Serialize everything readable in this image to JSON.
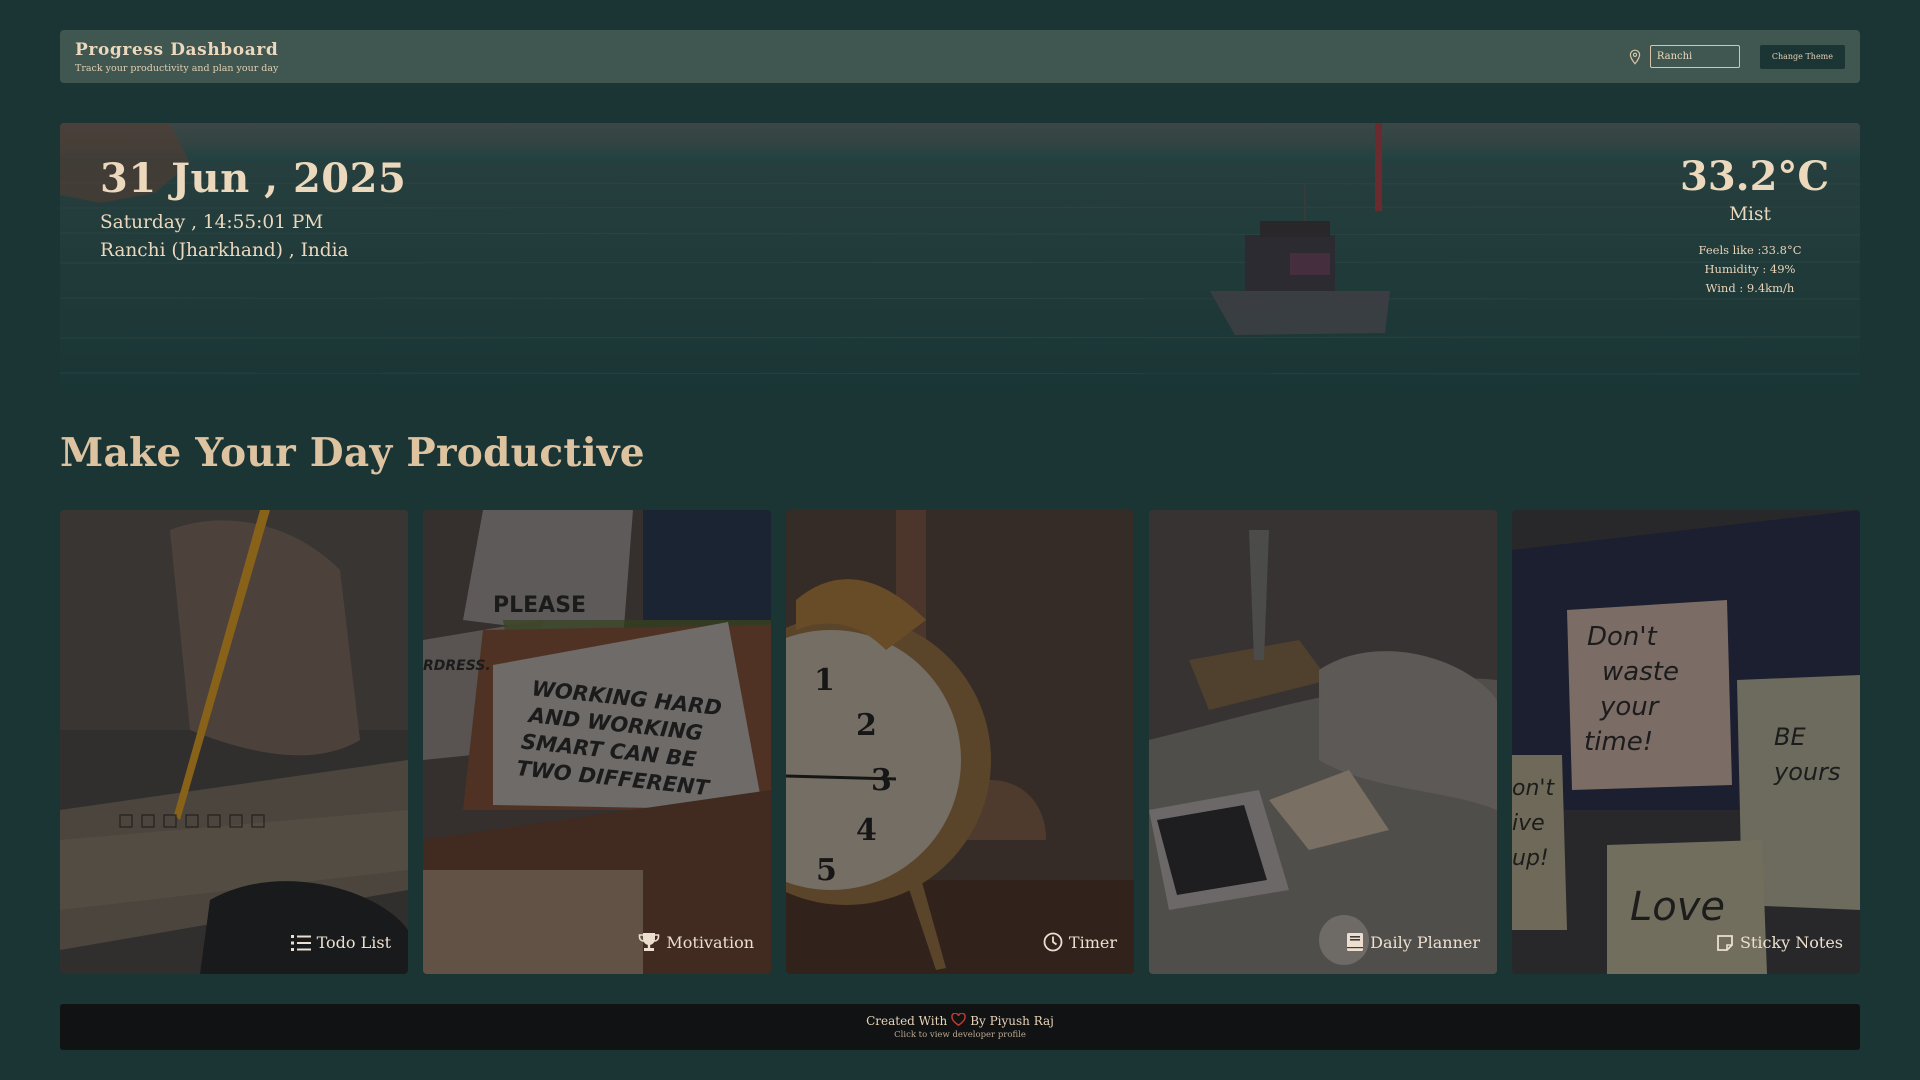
{
  "header": {
    "title": "Progress Dashboard",
    "subtitle": "Track your productivity and plan your day",
    "city_input_value": "Ranchi",
    "theme_button": "Change Theme"
  },
  "hero": {
    "date": "31 Jun , 2025",
    "day_time": "Saturday , 14:55:01 PM",
    "location": "Ranchi (Jharkhand) , India",
    "temperature": "33.2°C",
    "condition": "Mist",
    "feels_like": "Feels like :33.8°C",
    "humidity": "Humidity : 49%",
    "wind": "Wind : 9.4km/h"
  },
  "headline": "Make Your Day Productive",
  "cards": [
    {
      "label": "Todo List",
      "icon": "list-icon"
    },
    {
      "label": "Motivation",
      "icon": "trophy-icon"
    },
    {
      "label": "Timer",
      "icon": "clock-icon"
    },
    {
      "label": "Daily Planner",
      "icon": "book-icon"
    },
    {
      "label": "Sticky Notes",
      "icon": "sticky-note-icon"
    }
  ],
  "card_art_text": {
    "motivation_sign_top": "PLEASE",
    "motivation_sign_side": "RDRESS.",
    "motivation_sign_main": [
      "WORKING HARD",
      "AND WORKING",
      "SMART CAN BE",
      "TWO DIFFERENT"
    ],
    "sticky_note_main": [
      "Don't",
      "waste",
      "your",
      "time!"
    ],
    "sticky_note_right": [
      "BE",
      "yours"
    ],
    "sticky_note_bottom": "Love",
    "sticky_note_left": [
      "on't",
      "ive",
      "up!"
    ]
  },
  "footer": {
    "created_with": "Created With",
    "by": "By Piyush Raj",
    "sub": "Click to view developer profile"
  },
  "colors": {
    "page_bg": "#1b3535",
    "header_bg": "#3f5750",
    "text_accent": "#e8d3b8",
    "footer_bg": "#111213",
    "heart": "#c0392b"
  }
}
